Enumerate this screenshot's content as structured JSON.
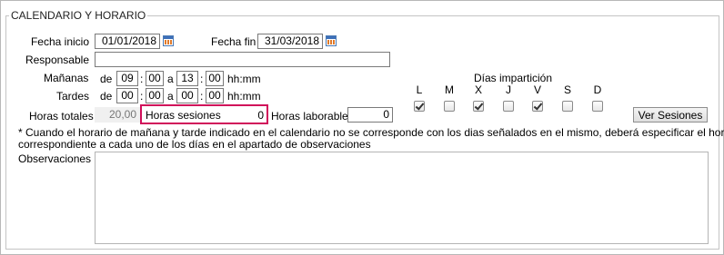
{
  "section": {
    "title": "CALENDARIO Y HORARIO"
  },
  "dates": {
    "start_label": "Fecha inicio",
    "start_value": "01/01/2018",
    "end_label": "Fecha fin",
    "end_value": "31/03/2018",
    "calendar_icon": "calendar-icon"
  },
  "responsable": {
    "label": "Responsable",
    "value": ""
  },
  "schedule": {
    "morning": {
      "label": "Mañanas",
      "from_prefix": "de",
      "from_h": "09",
      "from_m": "00",
      "to_prefix": "a",
      "to_h": "13",
      "to_m": "00",
      "format": "hh:mm"
    },
    "afternoon": {
      "label": "Tardes",
      "from_prefix": "de",
      "from_h": "00",
      "from_m": "00",
      "to_prefix": "a",
      "to_h": "00",
      "to_m": "00",
      "format": "hh:mm"
    },
    "sep": ":"
  },
  "totals": {
    "total_label": "Horas totales",
    "total_value": "20,00",
    "sessions_label": "Horas sesiones",
    "sessions_value": "0",
    "workable_label": "Horas laborables",
    "workable_value": "0"
  },
  "days": {
    "title": "Días impartición",
    "items": [
      {
        "label": "L",
        "checked": true
      },
      {
        "label": "M",
        "checked": false
      },
      {
        "label": "X",
        "checked": true
      },
      {
        "label": "J",
        "checked": false
      },
      {
        "label": "V",
        "checked": true
      },
      {
        "label": "S",
        "checked": false
      },
      {
        "label": "D",
        "checked": false
      }
    ]
  },
  "buttons": {
    "view_sessions": "Ver Sesiones"
  },
  "note": {
    "line1": "* Cuando el horario de mañana y tarde indicado en el calendario no se corresponde con los dias señalados en el mismo, deberá especificar el horario",
    "line2": "correspondiente a cada uno de los días en el apartado de observaciones"
  },
  "observations": {
    "label": "Observaciones",
    "value": ""
  },
  "colors": {
    "highlight": "#d10f5a"
  }
}
